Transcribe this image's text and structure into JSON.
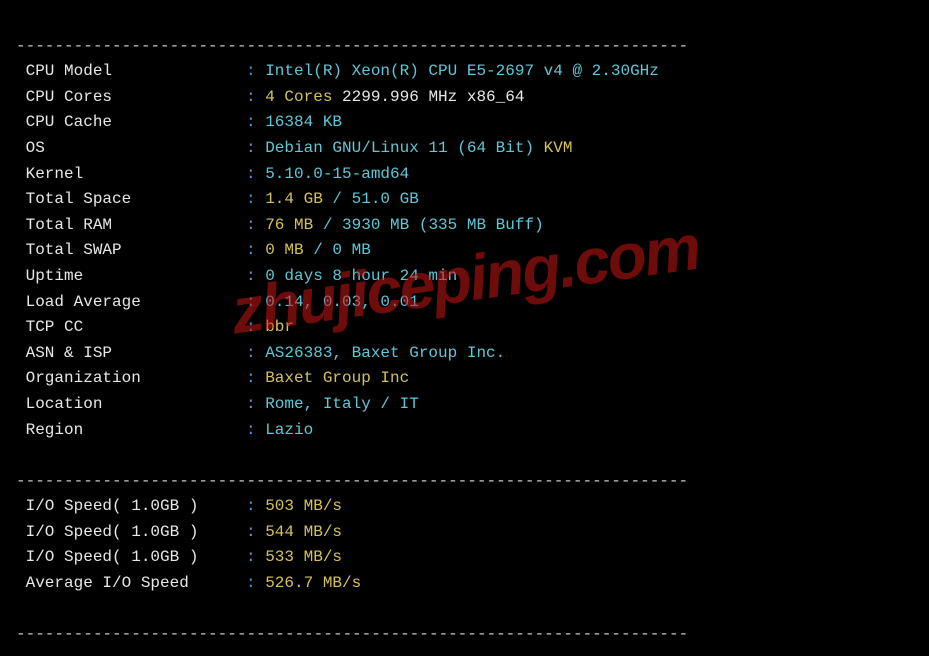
{
  "watermark": "zhujiceping.com",
  "divider": "----------------------------------------------------------------------",
  "rows": [
    {
      "label": "CPU Model",
      "parts": [
        {
          "cls": "cyan",
          "key": "cpu_model"
        }
      ]
    },
    {
      "label": "CPU Cores",
      "parts": [
        {
          "cls": "yellow",
          "key": "cpu_cores_count"
        },
        {
          "cls": "white",
          "key": "cpu_cores_rest"
        }
      ]
    },
    {
      "label": "CPU Cache",
      "parts": [
        {
          "cls": "cyan",
          "key": "cpu_cache"
        }
      ]
    },
    {
      "label": "OS",
      "parts": [
        {
          "cls": "cyan",
          "key": "os_name"
        },
        {
          "cls": "yellow",
          "key": "os_virt"
        }
      ]
    },
    {
      "label": "Kernel",
      "parts": [
        {
          "cls": "cyan",
          "key": "kernel"
        }
      ]
    },
    {
      "label": "Total Space",
      "parts": [
        {
          "cls": "yellow",
          "key": "space_used"
        },
        {
          "cls": "cyan",
          "key": "space_sep"
        },
        {
          "cls": "cyan",
          "key": "space_total"
        }
      ]
    },
    {
      "label": "Total RAM",
      "parts": [
        {
          "cls": "yellow",
          "key": "ram_used"
        },
        {
          "cls": "cyan",
          "key": "ram_sep"
        },
        {
          "cls": "cyan",
          "key": "ram_total"
        },
        {
          "cls": "cyan",
          "key": "ram_buff"
        }
      ]
    },
    {
      "label": "Total SWAP",
      "parts": [
        {
          "cls": "yellow",
          "key": "swap_used"
        },
        {
          "cls": "cyan",
          "key": "swap_sep"
        },
        {
          "cls": "cyan",
          "key": "swap_total"
        }
      ]
    },
    {
      "label": "Uptime",
      "parts": [
        {
          "cls": "cyan",
          "key": "uptime"
        }
      ]
    },
    {
      "label": "Load Average",
      "parts": [
        {
          "cls": "cyan",
          "key": "load"
        }
      ]
    },
    {
      "label": "TCP CC",
      "parts": [
        {
          "cls": "yellow",
          "key": "tcp_cc"
        }
      ]
    },
    {
      "label": "ASN & ISP",
      "parts": [
        {
          "cls": "cyan",
          "key": "asn"
        }
      ]
    },
    {
      "label": "Organization",
      "parts": [
        {
          "cls": "yellow",
          "key": "org"
        }
      ]
    },
    {
      "label": "Location",
      "parts": [
        {
          "cls": "cyan",
          "key": "location"
        }
      ]
    },
    {
      "label": "Region",
      "parts": [
        {
          "cls": "cyan",
          "key": "region"
        }
      ]
    }
  ],
  "io_rows": [
    {
      "label": "I/O Speed( 1.0GB )",
      "val_key": "io1"
    },
    {
      "label": "I/O Speed( 1.0GB )",
      "val_key": "io2"
    },
    {
      "label": "I/O Speed( 1.0GB )",
      "val_key": "io3"
    },
    {
      "label": "Average I/O Speed",
      "val_key": "io_avg"
    }
  ],
  "values": {
    "cpu_model": "Intel(R) Xeon(R) CPU E5-2697 v4 @ 2.30GHz",
    "cpu_cores_count": "4 Cores",
    "cpu_cores_rest": " 2299.996 MHz x86_64",
    "cpu_cache": "16384 KB",
    "os_name": "Debian GNU/Linux 11 (64 Bit) ",
    "os_virt": "KVM",
    "kernel": "5.10.0-15-amd64",
    "space_used": "1.4 GB",
    "space_sep": " / ",
    "space_total": "51.0 GB",
    "ram_used": "76 MB",
    "ram_sep": " / ",
    "ram_total": "3930 MB",
    "ram_buff": " (335 MB Buff)",
    "swap_used": "0 MB",
    "swap_sep": " / ",
    "swap_total": "0 MB",
    "uptime": "0 days 8 hour 24 min",
    "load": "0.14, 0.03, 0.01",
    "tcp_cc": "bbr",
    "asn": "AS26383, Baxet Group Inc.",
    "org": "Baxet Group Inc",
    "location": "Rome, Italy / IT",
    "region": "Lazio",
    "io1": "503 MB/s",
    "io2": "544 MB/s",
    "io3": "533 MB/s",
    "io_avg": "526.7 MB/s"
  }
}
